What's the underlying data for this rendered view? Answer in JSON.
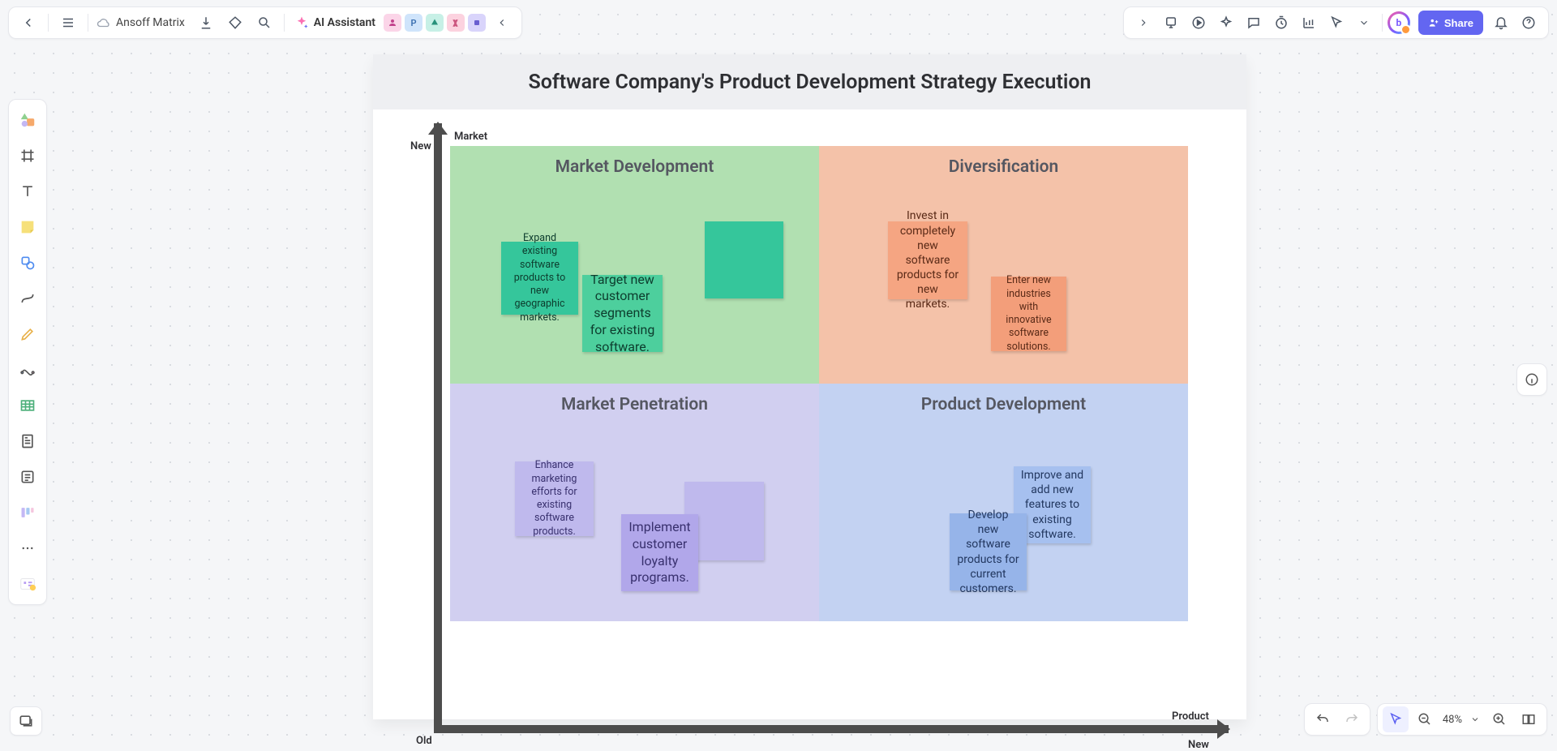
{
  "doc": {
    "title": "Ansoff Matrix"
  },
  "ai": {
    "label": "AI Assistant"
  },
  "share": {
    "label": "Share"
  },
  "zoom": {
    "value": "48%"
  },
  "avatars": {
    "a1": "",
    "a2": "P",
    "a3": "",
    "a4": "",
    "a5": ""
  },
  "brand": {
    "letter": "b"
  },
  "board": {
    "title": "Software Company's Product Development Strategy Execution",
    "axis": {
      "y": "Market",
      "x": "Product",
      "y_new": "New",
      "x_old": "Old",
      "x_new": "New"
    },
    "quadrants": {
      "tl": "Market Development",
      "tr": "Diversification",
      "bl": "Market Penetration",
      "br": "Product Development"
    },
    "stickies": {
      "tl1": "Expand existing software products to new geographic markets.",
      "tl2": "Target new customer segments for existing software.",
      "tl3": "",
      "tr1": "Invest in completely new software products for new markets.",
      "tr2": "Enter new industries with innovative software solutions.",
      "bl1": "Enhance marketing efforts for existing software products.",
      "bl2": "Implement customer loyalty programs.",
      "bl3": "",
      "br1": "Improve and add new features to existing software.",
      "br2": "Develop new software products for current customers."
    }
  }
}
